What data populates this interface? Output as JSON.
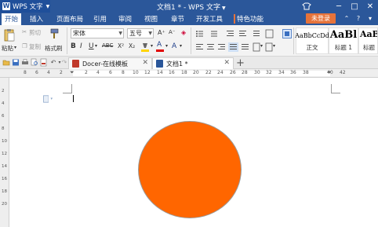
{
  "titlebar": {
    "app_logo": "W",
    "app_name": "WPS 文字",
    "window_title": "文档1 * - WPS 文字",
    "controls": [
      "─",
      "□",
      "✕"
    ]
  },
  "menu": {
    "items": [
      "开始",
      "插入",
      "页面布局",
      "引用",
      "审阅",
      "视图",
      "章节",
      "开发工具",
      "特色功能"
    ],
    "login_label": "未登录"
  },
  "ribbon": {
    "paste_label": "粘贴",
    "cut_label": "剪切",
    "copy_label": "复制",
    "format_painter_label": "格式刷",
    "font_name": "宋体",
    "font_size": "五号",
    "grow_font": "A⁺",
    "shrink_font": "A⁻",
    "bold": "B",
    "italic": "I",
    "underline": "U",
    "abc": "ABC",
    "superscript": "X²",
    "subscript": "X₂",
    "font_color": "A",
    "highlight_color": "#ffd400",
    "font_color_bar": "#e00000",
    "styles": [
      {
        "sample": "AaBbCcDd",
        "name": "正文"
      },
      {
        "sample": "AaBl",
        "name": "标题 1"
      },
      {
        "sample": "AaB",
        "name": "标题"
      }
    ]
  },
  "tabs": [
    {
      "label": "Docer-在线模板",
      "icon_color": "#c0392b"
    },
    {
      "label": "文档1 *",
      "icon_color": "#2b579a"
    }
  ],
  "ruler": {
    "numbers": [
      "8",
      "6",
      "4",
      "2",
      "2",
      "4",
      "6",
      "8",
      "10",
      "12",
      "14",
      "16",
      "18",
      "20",
      "22",
      "24",
      "26",
      "28",
      "30",
      "32",
      "34",
      "36",
      "38",
      "40",
      "42"
    ]
  },
  "vruler": {
    "numbers": [
      "2",
      "4",
      "6",
      "8",
      "10",
      "12",
      "14",
      "16",
      "18",
      "20"
    ]
  },
  "canvas": {
    "shape": "circle",
    "fill": "#ff6600",
    "stroke": "#9a9a9a"
  }
}
